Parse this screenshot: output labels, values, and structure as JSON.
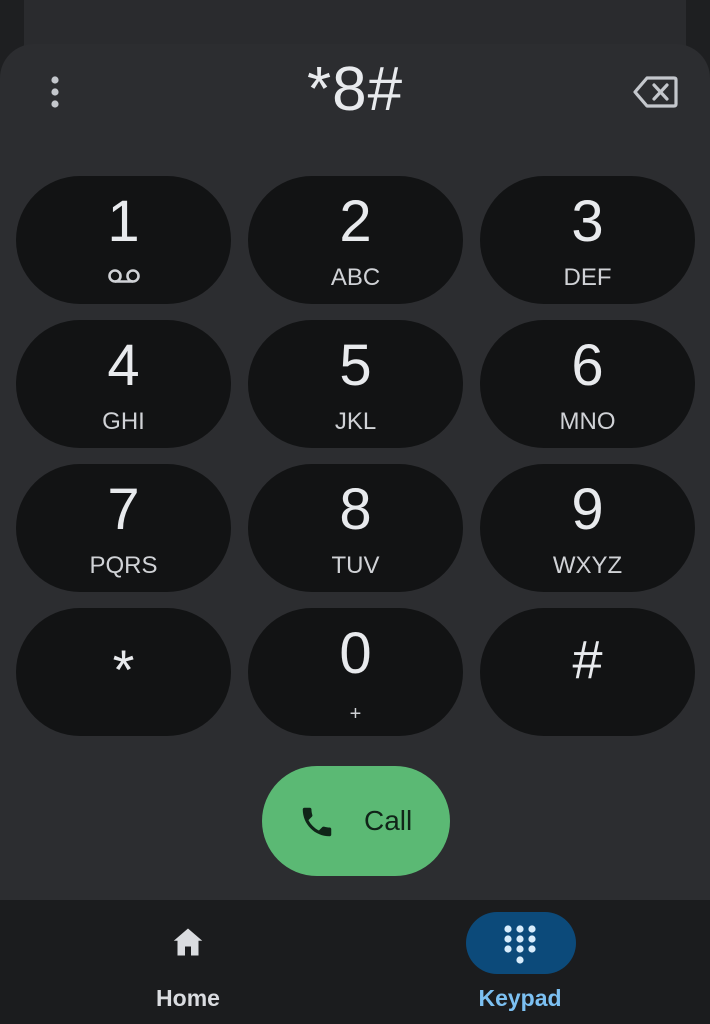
{
  "dialer": {
    "number": "*8#",
    "menu_icon": "more-vert-icon",
    "backspace_icon": "backspace-icon"
  },
  "keys": [
    {
      "digit": "1",
      "letters": "",
      "icon": "voicemail-icon"
    },
    {
      "digit": "2",
      "letters": "ABC"
    },
    {
      "digit": "3",
      "letters": "DEF"
    },
    {
      "digit": "4",
      "letters": "GHI"
    },
    {
      "digit": "5",
      "letters": "JKL"
    },
    {
      "digit": "6",
      "letters": "MNO"
    },
    {
      "digit": "7",
      "letters": "PQRS"
    },
    {
      "digit": "8",
      "letters": "TUV"
    },
    {
      "digit": "9",
      "letters": "WXYZ"
    },
    {
      "digit": "*",
      "letters": ""
    },
    {
      "digit": "0",
      "letters": "+"
    },
    {
      "digit": "#",
      "letters": ""
    }
  ],
  "call_button": {
    "label": "Call",
    "icon": "phone-icon",
    "color": "#5bb974"
  },
  "bottom_nav": {
    "items": [
      {
        "label": "Home",
        "icon": "home-icon",
        "active": false
      },
      {
        "label": "Keypad",
        "icon": "dialpad-icon",
        "active": true
      }
    ],
    "active_color": "#7cc0f2",
    "active_pill_color": "#0c4a7a"
  },
  "colors": {
    "background": "#2c2d30",
    "key_background": "#121314",
    "text": "#e8eaed"
  }
}
